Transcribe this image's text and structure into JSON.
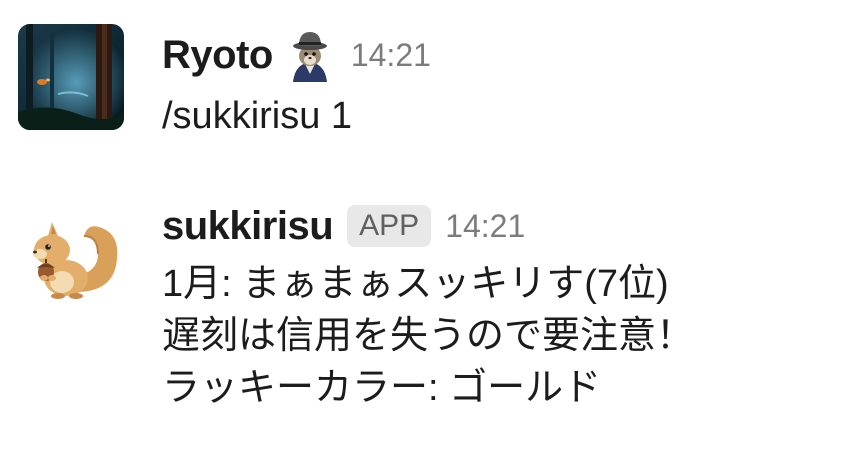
{
  "messages": [
    {
      "sender": "Ryoto",
      "status_emoji": "squirrel-in-fedora-icon",
      "timestamp": "14:21",
      "text": "/sukkirisu 1",
      "avatar": "dark-forest-avatar"
    },
    {
      "sender": "sukkirisu",
      "badge": "APP",
      "timestamp": "14:21",
      "lines": [
        "1月: まぁまぁスッキリす(7位)",
        "遅刻は信用を失うので要注意！",
        "ラッキーカラー: ゴールド"
      ],
      "avatar": "squirrel-with-acorn-avatar"
    }
  ],
  "colors": {
    "sender": "#1d1c1d",
    "timestamp": "#7d7c7d",
    "badge_bg": "#e8e8e8",
    "badge_text": "#616061"
  }
}
